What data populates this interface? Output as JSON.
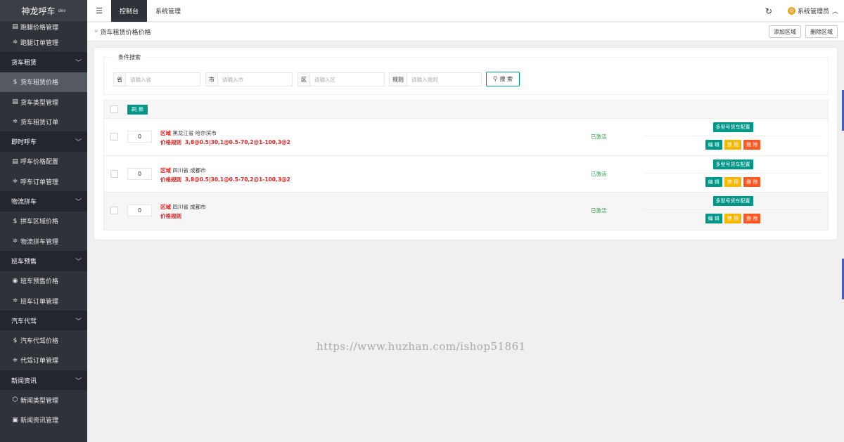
{
  "app": {
    "title": "神龙呼车",
    "env": "dev"
  },
  "sidebar": {
    "items": [
      {
        "type": "item",
        "icon": "list-icon",
        "glyph": "▤",
        "label": "跑腿价格管理",
        "first": true
      },
      {
        "type": "item",
        "icon": "sliders-icon",
        "glyph": "≑",
        "label": "跑腿订单管理"
      },
      {
        "type": "group",
        "label": "货车租赁"
      },
      {
        "type": "item",
        "icon": "dollar-icon",
        "glyph": "$",
        "label": "货车租赁价格",
        "active": true
      },
      {
        "type": "item",
        "icon": "list-icon",
        "glyph": "▤",
        "label": "货车类型管理"
      },
      {
        "type": "item",
        "icon": "sliders-icon",
        "glyph": "≑",
        "label": "货车租赁订单"
      },
      {
        "type": "group",
        "label": "即时呼车"
      },
      {
        "type": "item",
        "icon": "list-icon",
        "glyph": "▤",
        "label": "呼车价格配置"
      },
      {
        "type": "item",
        "icon": "sliders-icon",
        "glyph": "≑",
        "label": "呼车订单管理"
      },
      {
        "type": "group",
        "label": "物流拼车"
      },
      {
        "type": "item",
        "icon": "dollar-icon",
        "glyph": "$",
        "label": "拼车区域价格"
      },
      {
        "type": "item",
        "icon": "sliders-icon",
        "glyph": "≑",
        "label": "物流拼车管理"
      },
      {
        "type": "group",
        "label": "班车预售"
      },
      {
        "type": "item",
        "icon": "target-icon",
        "glyph": "◉",
        "label": "班车预售价格"
      },
      {
        "type": "item",
        "icon": "sliders-icon",
        "glyph": "≑",
        "label": "班车订单管理"
      },
      {
        "type": "group",
        "label": "汽车代驾"
      },
      {
        "type": "item",
        "icon": "dollar-icon",
        "glyph": "$",
        "label": "汽车代驾价格"
      },
      {
        "type": "item",
        "icon": "sliders-icon",
        "glyph": "≑",
        "label": "代驾订单管理"
      },
      {
        "type": "group",
        "label": "新闻资讯"
      },
      {
        "type": "item",
        "icon": "cube-icon",
        "glyph": "⬡",
        "label": "新闻类型管理"
      },
      {
        "type": "item",
        "icon": "doc-icon",
        "glyph": "▣",
        "label": "新闻资讯管理"
      }
    ]
  },
  "topbar": {
    "menu_glyph": "☰",
    "tabs": [
      "控制台",
      "系统管理"
    ],
    "refresh_glyph": "↻",
    "admin_name": "系统管理员",
    "admin_chev": "︿"
  },
  "crumbbar": {
    "sep": "»",
    "title": "货车租赁价格价格",
    "add_label": "添加区域",
    "delete_label": "删除区域"
  },
  "search": {
    "legend": "条件搜索",
    "fields": [
      {
        "label": "省",
        "placeholder": "请输入省"
      },
      {
        "label": "市",
        "placeholder": "请输入市"
      },
      {
        "label": "区",
        "placeholder": "请输入区"
      },
      {
        "label": "规则",
        "placeholder": "请输入规则"
      }
    ],
    "button_label": "搜 索"
  },
  "list": {
    "refresh_label": "刷 新",
    "region_key": "区域",
    "rule_key": "价格规则",
    "rows": [
      {
        "qty": "0",
        "region": "黑龙江省 哈尔滨市",
        "rule": "3,8@0.5|30,1@0.5-70,2@1-100,3@2",
        "status": "已激活"
      },
      {
        "qty": "0",
        "region": "四川省 成都市",
        "rule": "3,8@0.5|30,1@0.5-70,2@1-100,3@2",
        "status": "已激活"
      },
      {
        "qty": "0",
        "region": "四川省 成都市",
        "rule": "",
        "status": "已激活"
      }
    ],
    "ops": {
      "config": "多型号货车配置",
      "edit": "编 辑",
      "disable": "禁 用",
      "delete": "删 除"
    }
  },
  "watermark": "https://www.huzhan.com/ishop51861",
  "colors": {
    "sidebar_bg": "#2f3239",
    "accent": "#009688",
    "warn": "#f5b800",
    "danger": "#ff5722",
    "status_ok": "#2e9d4e",
    "rule_red": "#e02020"
  }
}
